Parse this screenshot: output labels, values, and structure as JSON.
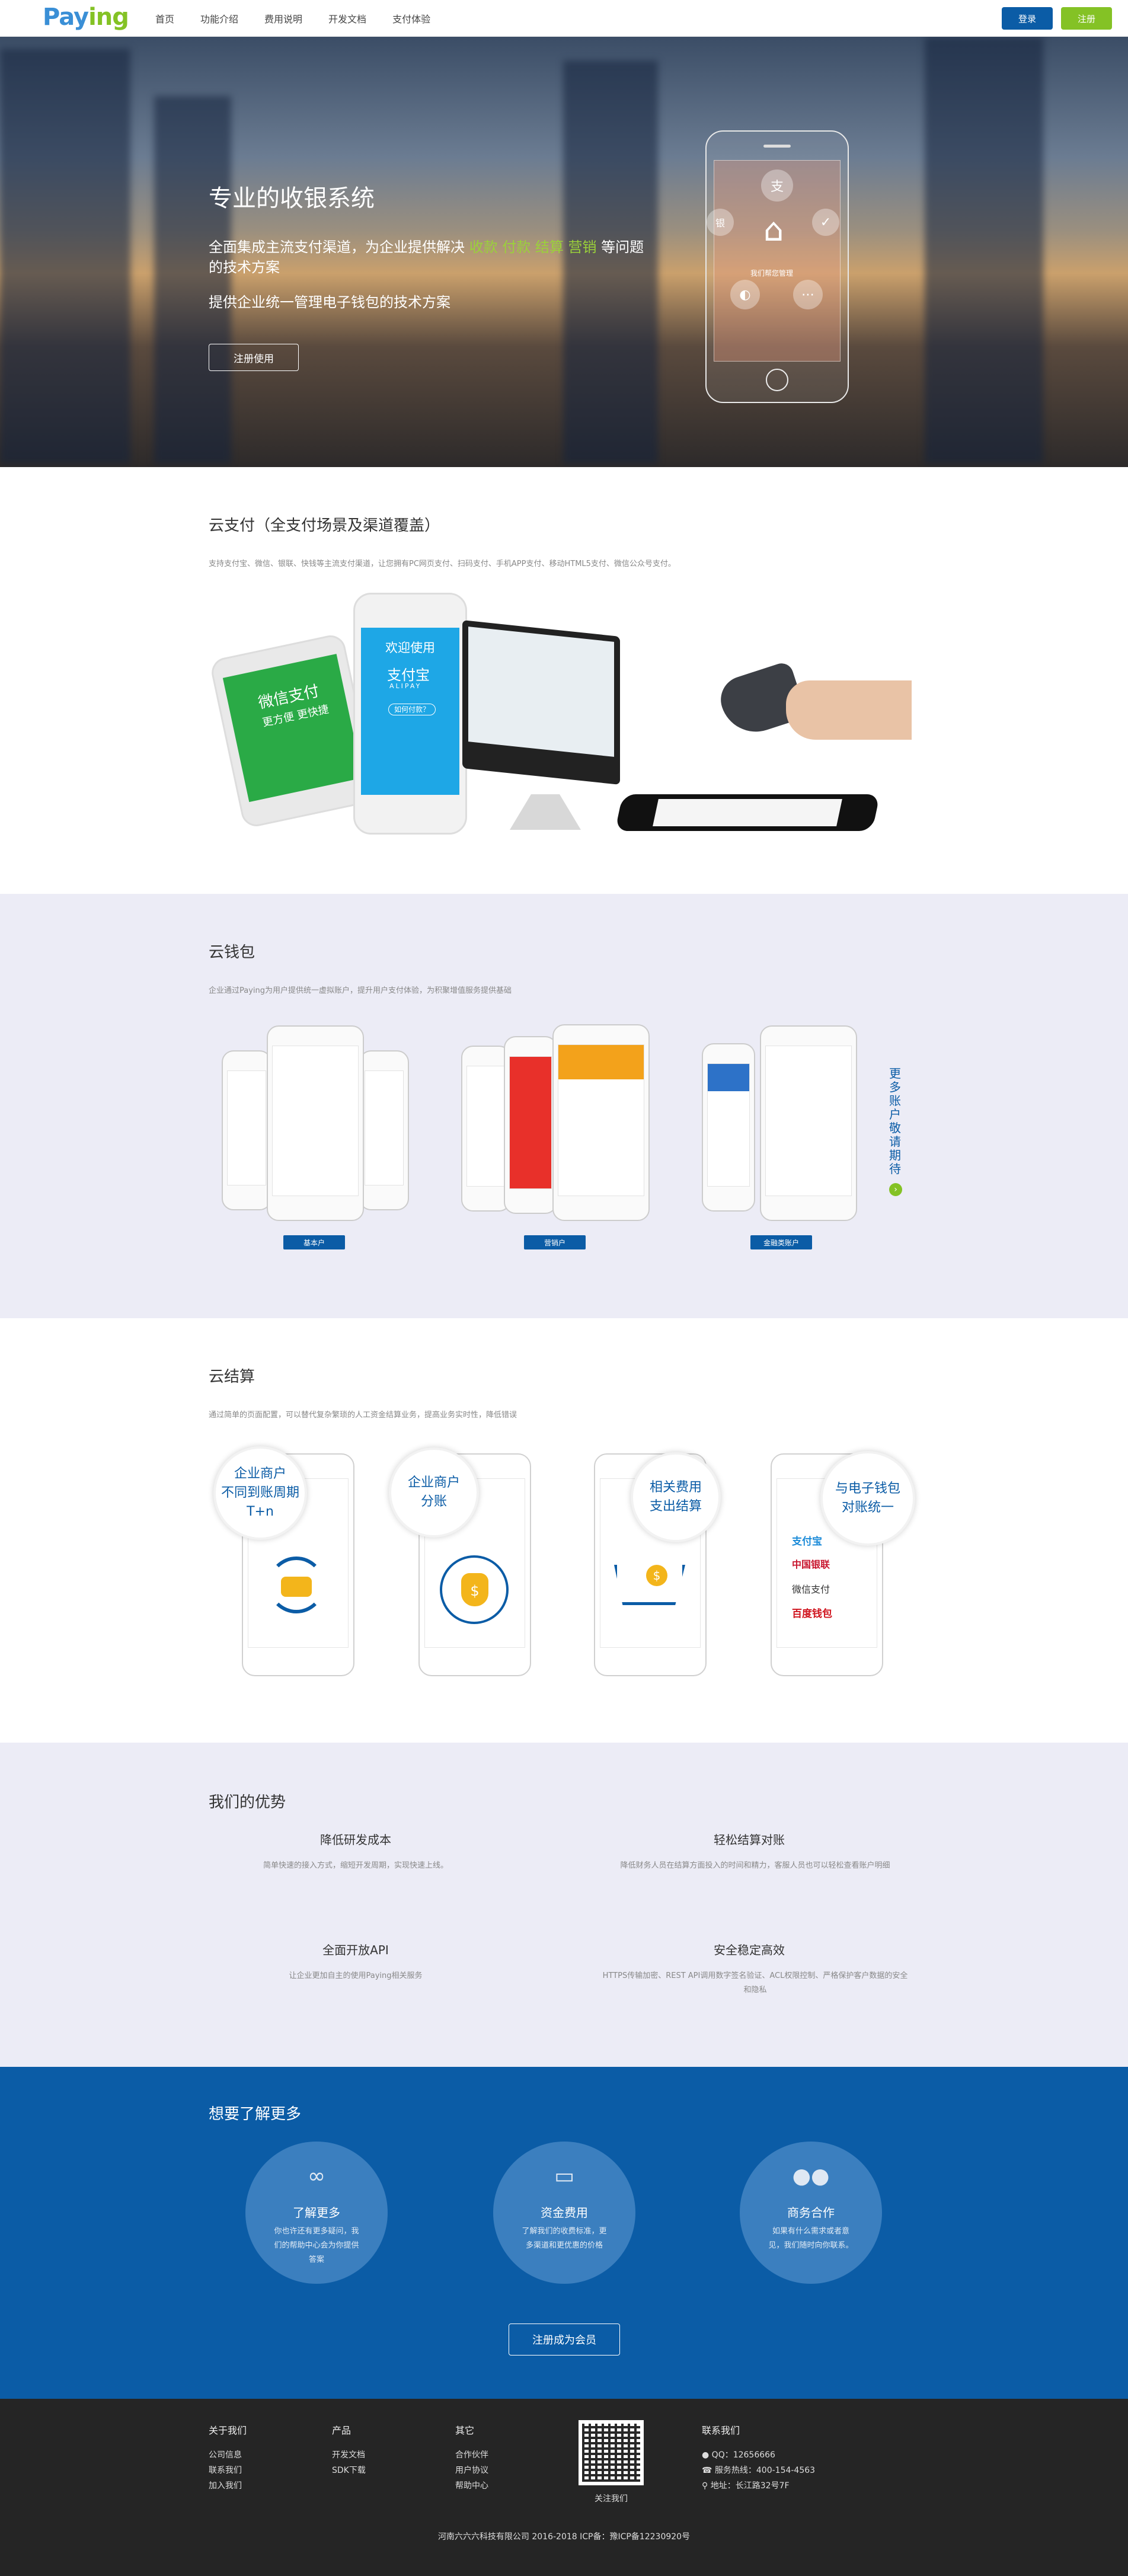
{
  "header": {
    "logo": {
      "part1": "Pay",
      "part2": "ing"
    },
    "nav": [
      "首页",
      "功能介绍",
      "费用说明",
      "开发文档",
      "支付体验"
    ],
    "login": "登录",
    "register": "注册"
  },
  "hero": {
    "title": "专业的收银系统",
    "line1_a": "全面集成主流支付渠道，为企业提供解决",
    "line1_hl": "收款 付款 结算 营销",
    "line1_b": "等问题的技术方案",
    "line2": "提供企业统一管理电子钱包的技术方案",
    "cta": "注册使用",
    "phone_label": "我们帮您管理"
  },
  "cloud_pay": {
    "title": "云支付（全支付场景及渠道覆盖）",
    "desc": "支持支付宝、微信、银联、快钱等主流支付渠道，让您拥有PC网页支付、扫码支付、手机APP支付、移动HTML5支付、微信公众号支付。",
    "wechat_title": "微信支付",
    "wechat_sub": "更方便 更快捷",
    "alipay_welcome": "欢迎使用",
    "alipay_brand": "支付宝",
    "alipay_latin": "ALIPAY",
    "alipay_q": "如何付款？"
  },
  "wallet": {
    "title": "云钱包",
    "desc": "企业通过Paying为用户提供统一虚拟账户，提升用户支付体验，为积聚增值服务提供基础",
    "tags": [
      "基本户",
      "营销户",
      "金融类账户"
    ],
    "more": "更多账户 敬请期待"
  },
  "settle": {
    "title": "云结算",
    "desc": "通过简单的页面配置，可以替代复杂繁琐的人工资金结算业务，提高业务实时性，降低错误",
    "bubbles": [
      "企业商户\n不同到账周期\nT+n",
      "企业商户\n分账",
      "相关费用\n支出结算",
      "与电子钱包\n对账统一"
    ],
    "brands": [
      "支付宝",
      "中国银联",
      "微信支付",
      "百度钱包"
    ]
  },
  "advantages": {
    "title": "我们的优势",
    "items": [
      {
        "title": "降低研发成本",
        "desc": "简单快速的接入方式，缩短开发周期，实现快速上线。"
      },
      {
        "title": "轻松结算对账",
        "desc": "降低财务人员在结算方面投入的时间和精力，客服人员也可以轻松查看账户明细"
      },
      {
        "title": "全面开放API",
        "desc": "让企业更加自主的使用Paying相关服务"
      },
      {
        "title": "安全稳定高效",
        "desc": "HTTPS传输加密、REST API调用数字签名验证、ACL权限控制、严格保护客户数据的安全和隐私"
      }
    ]
  },
  "more": {
    "title": "想要了解更多",
    "items": [
      {
        "title": "了解更多",
        "desc": "你也许还有更多疑问，我们的帮助中心会为你提供答案"
      },
      {
        "title": "资金费用",
        "desc": "了解我们的收费标准，更多渠道和更优惠的价格"
      },
      {
        "title": "商务合作",
        "desc": "如果有什么需求或者意见，我们随时向你联系。"
      }
    ],
    "join": "注册成为会员"
  },
  "footer": {
    "cols": [
      {
        "title": "关于我们",
        "links": [
          "公司信息",
          "联系我们",
          "加入我们"
        ]
      },
      {
        "title": "产品",
        "links": [
          "开发文档",
          "SDK下载"
        ]
      },
      {
        "title": "其它",
        "links": [
          "合作伙伴",
          "用户协议",
          "帮助中心"
        ]
      }
    ],
    "qr_label": "关注我们",
    "contact": {
      "title": "联系我们",
      "qq": "QQ：12656666",
      "phone": "服务热线：400-154-4563",
      "addr": "地址：长江路32号7F"
    },
    "copyright": "河南六六六科技有限公司   2016-2018   ICP备：豫ICP备12230920号"
  },
  "colors": {
    "brand_blue": "#0b5ca6",
    "brand_green": "#84c225",
    "light_section": "#ececf6"
  }
}
